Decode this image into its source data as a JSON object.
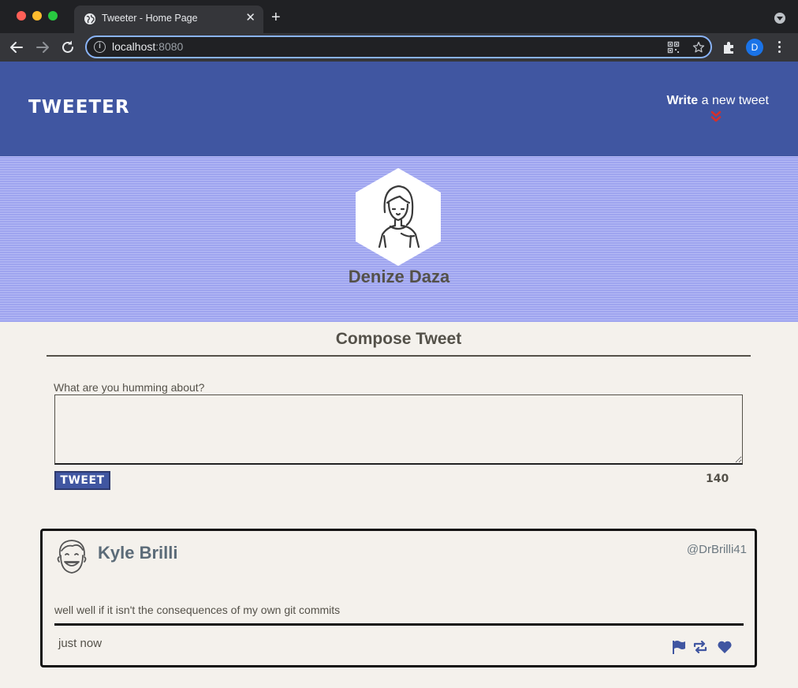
{
  "browser": {
    "tab_title": "Tweeter - Home Page",
    "tab_close": "✕",
    "new_tab": "+",
    "url_host": "localhost",
    "url_port": ":8080",
    "profile_initial": "D"
  },
  "navbar": {
    "brand": "TWEETER",
    "write_strong": "Write",
    "write_rest": " a new tweet"
  },
  "profile": {
    "name": "Denize Daza"
  },
  "compose": {
    "title": "Compose Tweet",
    "label": "What are you humming about?",
    "text": "",
    "button": "TWEET",
    "counter": "140"
  },
  "tweets": [
    {
      "name": "Kyle Brilli",
      "handle": "@DrBrilli41",
      "body": "well well if it isn't the consequences of my own git commits",
      "time": "just now"
    }
  ],
  "colors": {
    "header": "#4056a1",
    "page_bg": "#f4f1ec",
    "accent_red": "#d3302c",
    "hero_stripe": "#9ea4ef"
  }
}
